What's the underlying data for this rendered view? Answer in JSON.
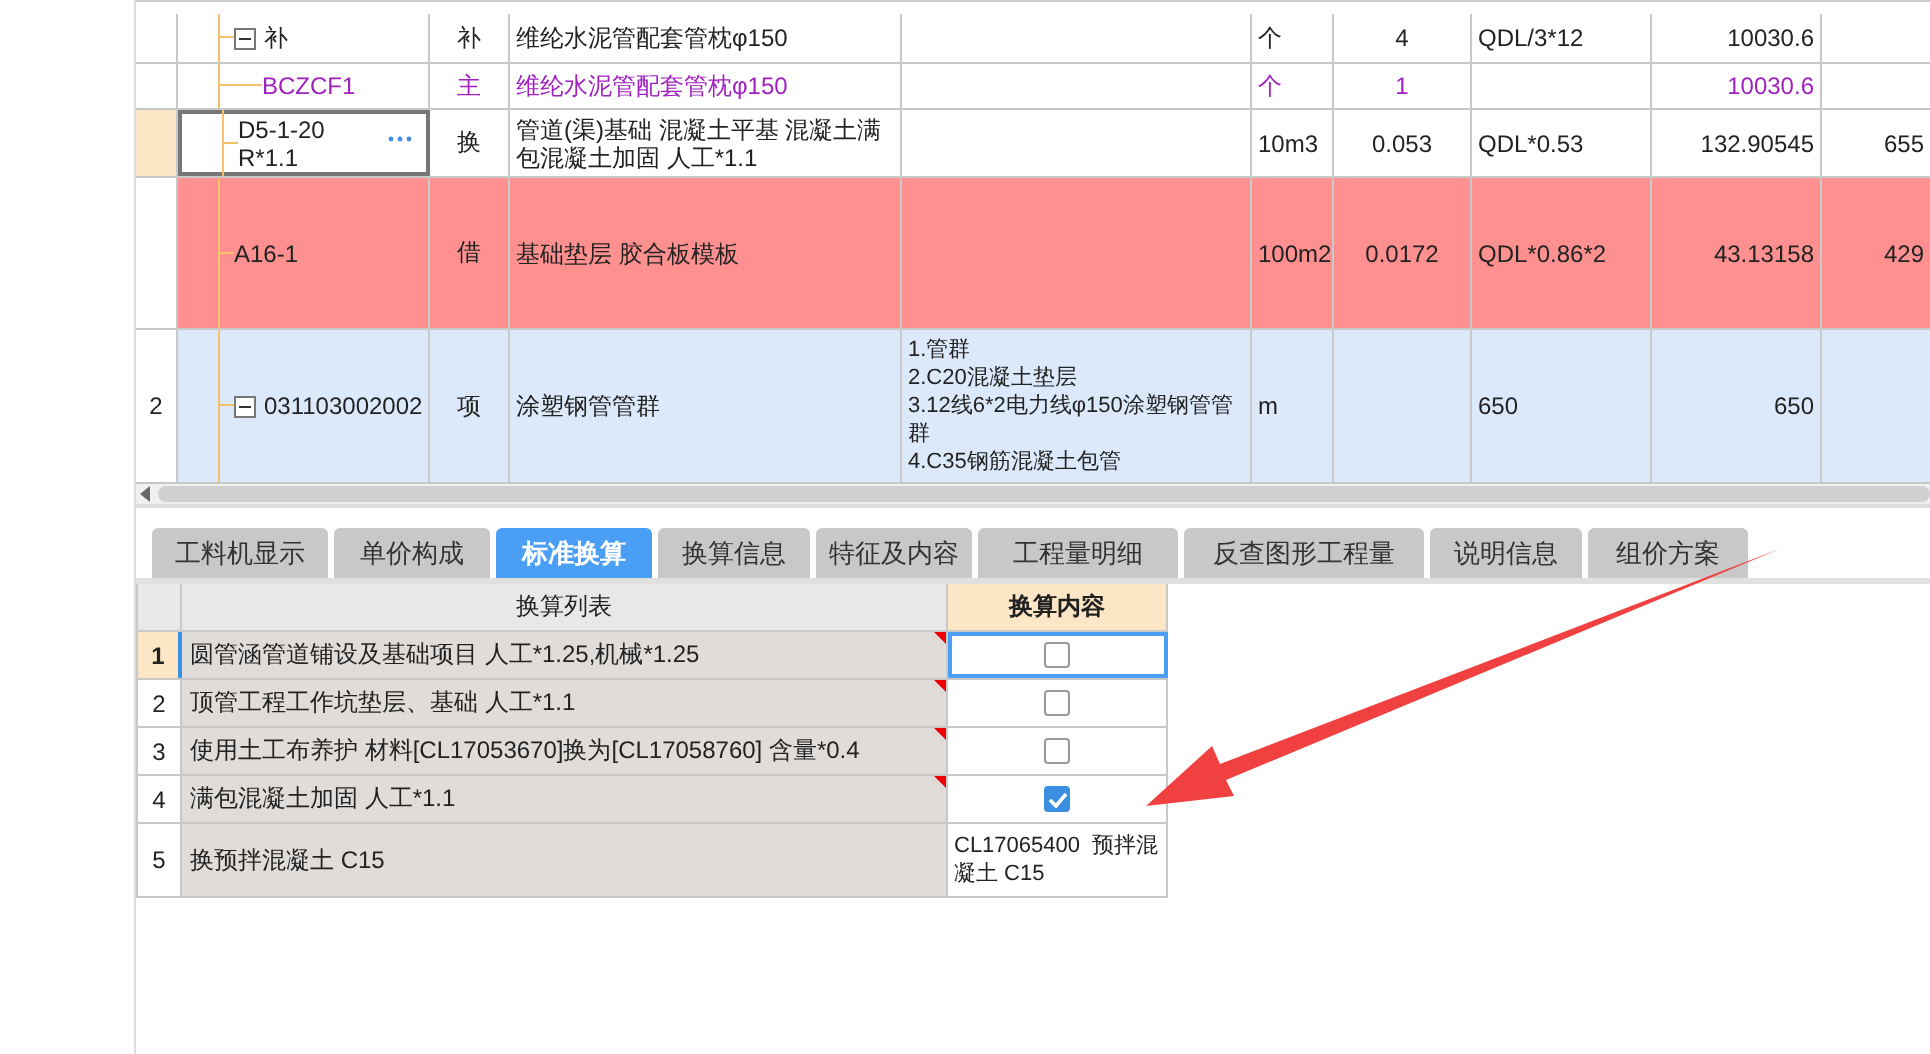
{
  "grid": {
    "rows": [
      {
        "code": "补",
        "expanded": true,
        "type": "补",
        "name": "维纶水泥管配套管枕φ150",
        "unit": "个",
        "quantity": "4",
        "expression": "QDL/3*12",
        "unit_price": "10030.6",
        "kind": "normal",
        "selected": false,
        "children": [
          {
            "code": "BCZCF1",
            "type": "主",
            "name": "维纶水泥管配套管枕φ150",
            "unit": "个",
            "quantity": "1",
            "unit_price": "10030.6",
            "kind": "material",
            "selected": false
          }
        ]
      },
      {
        "code": "D5-1-20\nR*1.1",
        "type": "换",
        "name": "管道(渠)基础 混凝土平基 混凝土满包混凝土加固 人工*1.1",
        "unit": "10m3",
        "quantity": "0.053",
        "expression": "QDL*0.53",
        "unit_price": "132.90545",
        "total": "655",
        "kind": "normal",
        "selected": true
      },
      {
        "code": "A16-1",
        "type": "借",
        "name": "基础垫层 胶合板模板",
        "unit": "100m2",
        "quantity": "0.0172",
        "expression": "QDL*0.86*2",
        "unit_price": "43.13158",
        "total": "429",
        "kind": "error",
        "selected": false
      },
      {
        "row_number": "2",
        "code": "031103002002",
        "expanded": true,
        "type": "项",
        "name": "涂塑钢管管群",
        "features": "1.管群\n2.C20混凝土垫层\n3.12线6*2电力线φ150涂塑钢管管群\n4.C35钢筋混凝土包管",
        "unit": "m",
        "expression": "650",
        "unit_price": "650",
        "kind": "item",
        "selected": false
      }
    ]
  },
  "tabs": [
    {
      "label": "工料机显示",
      "selected": false
    },
    {
      "label": "单价构成",
      "selected": false
    },
    {
      "label": "标准换算",
      "selected": true
    },
    {
      "label": "换算信息",
      "selected": false
    },
    {
      "label": "特征及内容",
      "selected": false
    },
    {
      "label": "工程量明细",
      "selected": false
    },
    {
      "label": "反查图形工程量",
      "selected": false
    },
    {
      "label": "说明信息",
      "selected": false
    },
    {
      "label": "组价方案",
      "selected": false
    }
  ],
  "conversion_table": {
    "columns": [
      "换算列表",
      "换算内容"
    ],
    "rows": [
      {
        "number": "1",
        "text": "圆管涵管道铺设及基础项目 人工*1.25,机械*1.25",
        "flagged": true,
        "selected": true,
        "kind": "checkbox",
        "checked": false
      },
      {
        "number": "2",
        "text": "顶管工程工作坑垫层、基础 人工*1.1",
        "flagged": true,
        "selected": false,
        "kind": "checkbox",
        "checked": false
      },
      {
        "number": "3",
        "text": "使用土工布养护 材料[CL17053670]换为[CL17058760] 含量*0.4",
        "flagged": true,
        "selected": false,
        "kind": "checkbox",
        "checked": false
      },
      {
        "number": "4",
        "text": "满包混凝土加固 人工*1.1",
        "flagged": true,
        "selected": false,
        "kind": "checkbox",
        "checked": true
      },
      {
        "number": "5",
        "text": "换预拌混凝土 C15",
        "flagged": false,
        "selected": false,
        "kind": "text",
        "value": "CL17065400  预拌混凝土 C15"
      }
    ]
  }
}
